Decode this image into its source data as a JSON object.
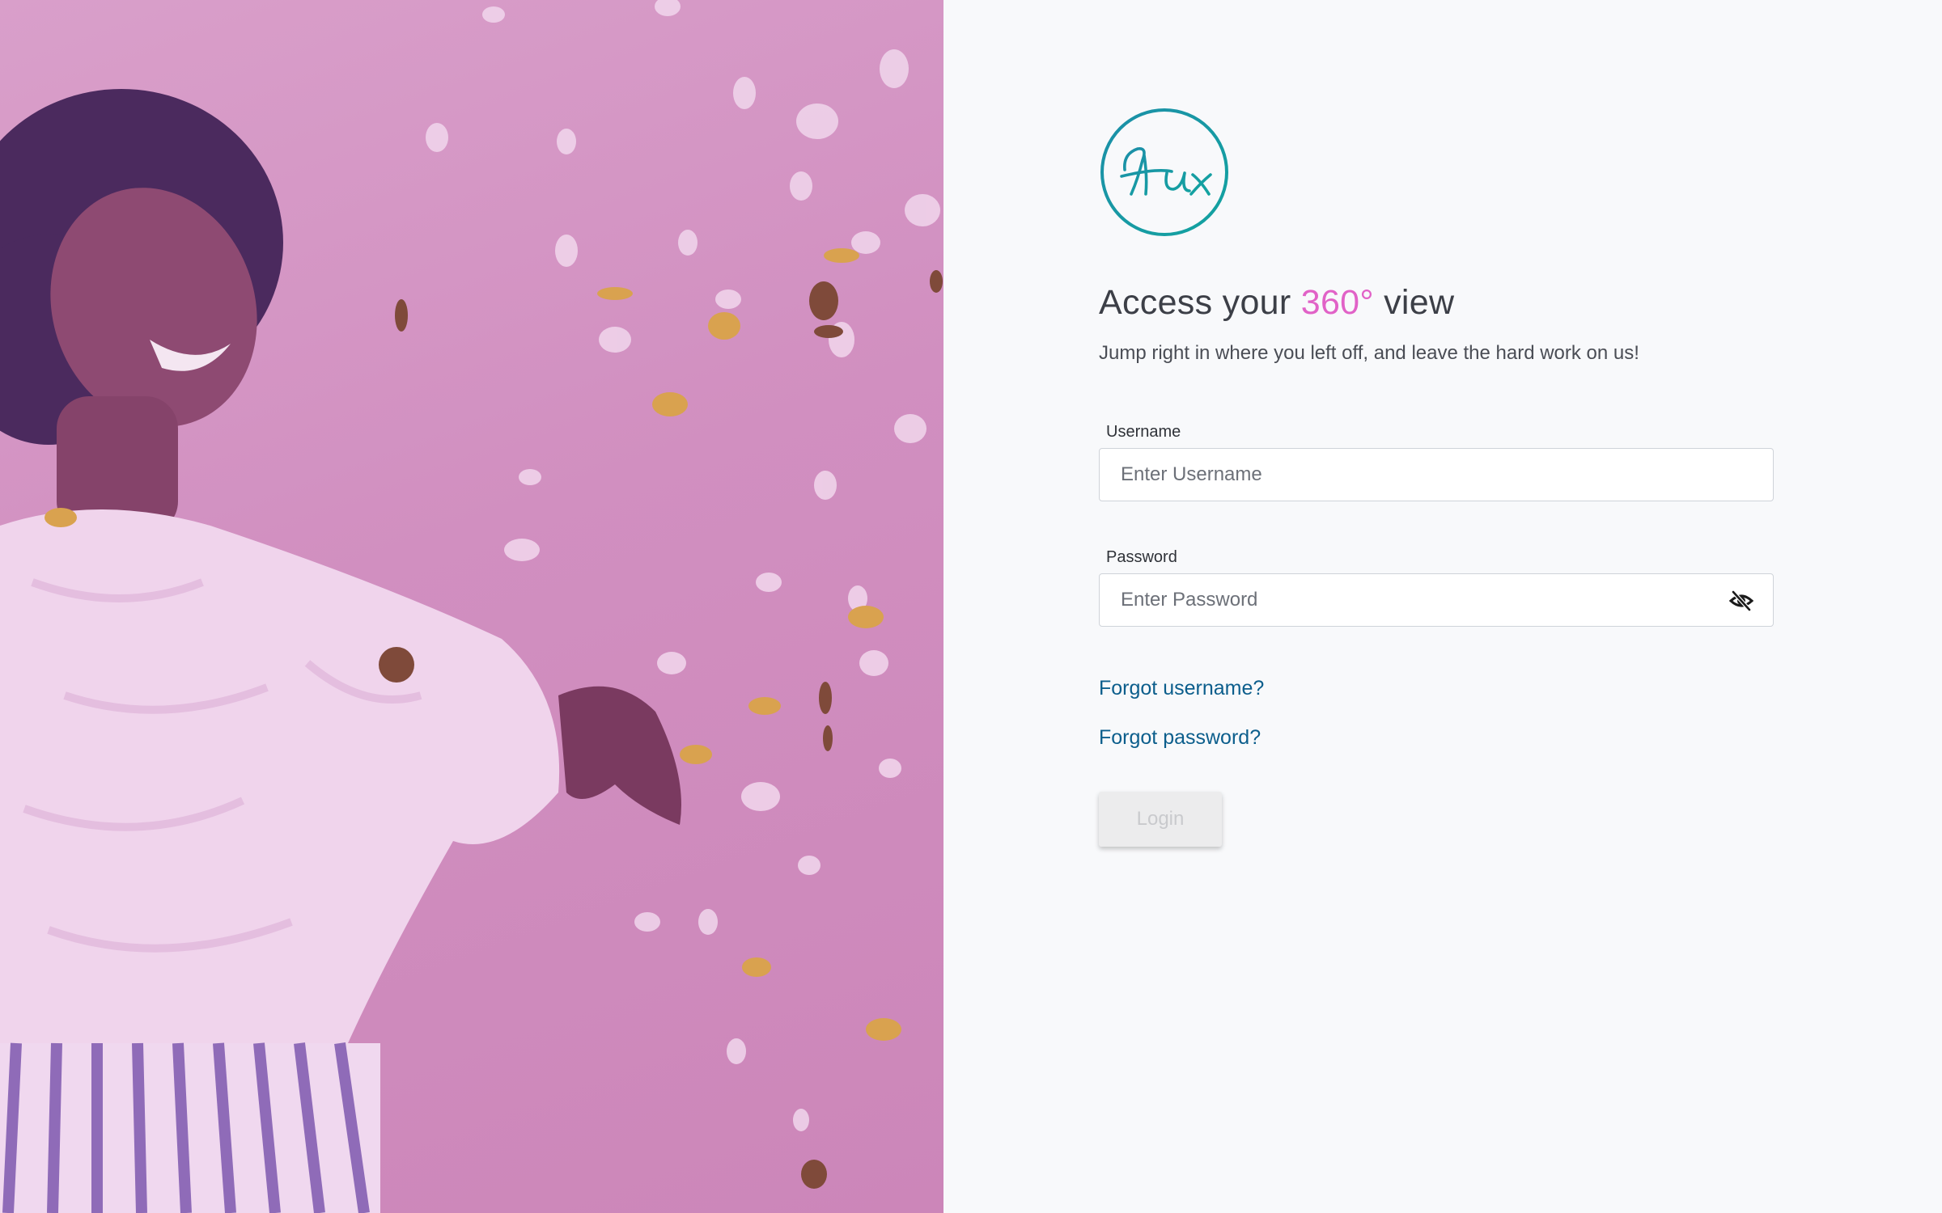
{
  "brand": {
    "logo_text": "Hux",
    "logo_color": "#1a97a6"
  },
  "headline": {
    "prefix": "Access your ",
    "accent": "360°",
    "suffix": " view",
    "accent_color": "#e162c7"
  },
  "subline": "Jump right in where you left off, and leave the hard work on us!",
  "form": {
    "username": {
      "label": "Username",
      "placeholder": "Enter Username",
      "value": ""
    },
    "password": {
      "label": "Password",
      "placeholder": "Enter Password",
      "value": "",
      "toggle_icon": "eye-slash-icon"
    },
    "forgot_username": "Forgot username?",
    "forgot_password": "Forgot password?",
    "login_label": "Login",
    "login_enabled": false
  },
  "colors": {
    "hero_overlay": "#d18fc0",
    "link": "#0c5e8c",
    "page_background": "#f8f9fb"
  }
}
